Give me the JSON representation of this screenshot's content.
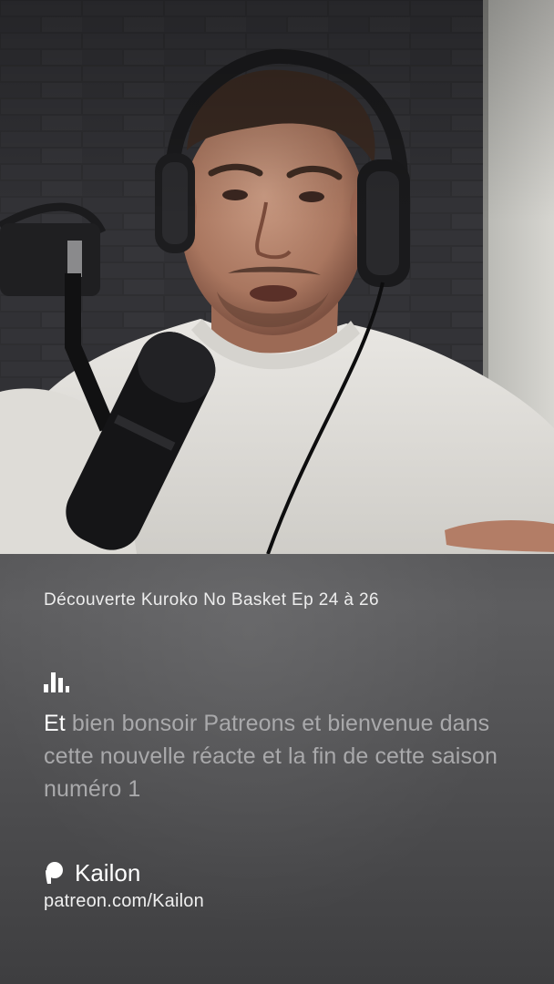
{
  "episode": {
    "title": "Découverte Kuroko No Basket Ep 24 à 26"
  },
  "transcript": {
    "active_word": "Et",
    "rest": " bien bonsoir Patreons et bienvenue dans cette nouvelle réacte et la fin de cette saison numéro 1"
  },
  "creator": {
    "name": "Kailon",
    "url": "patreon.com/Kailon"
  },
  "icons": {
    "audio": "audio-waveform-icon",
    "brand": "patreon-logo-icon"
  },
  "colors": {
    "card_top": "#5d5d5f",
    "card_bottom": "#3e3e40",
    "text_active": "#ffffff",
    "text_inactive": "#a9a9ab"
  }
}
